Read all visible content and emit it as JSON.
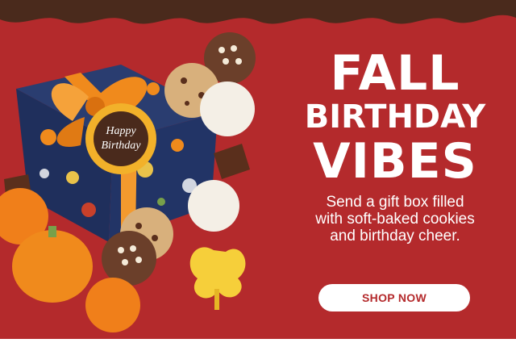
{
  "banner": {
    "headline_line1": "FALL",
    "headline_line2": "BIRTHDAY",
    "headline_line3": "VIBES",
    "subtext": "Send a gift box filled\nwith soft-baked cookies\nand birthday cheer.",
    "cta_label": "SHOP NOW"
  },
  "gift_tag": {
    "line1": "Happy",
    "line2": "Birthday"
  },
  "colors": {
    "background_red": "#b42a2c",
    "chocolate_band": "#4a2a1c",
    "ribbon_orange": "#f08a1c",
    "box_navy": "#1f2f5c",
    "cta_text": "#b42a2c",
    "cta_background": "#ffffff"
  }
}
